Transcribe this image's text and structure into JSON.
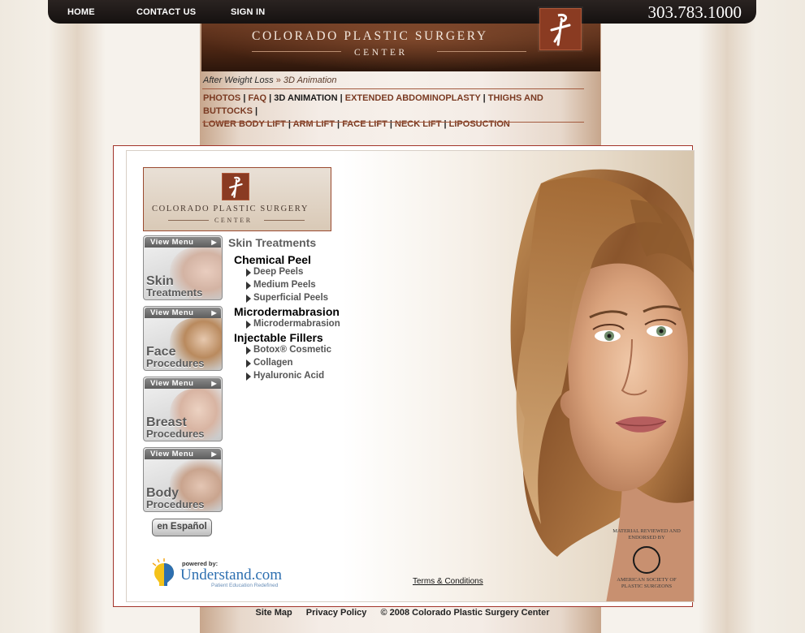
{
  "topnav": {
    "home": "HOME",
    "contact": "CONTACT US",
    "signin": "SIGN IN",
    "phone": "303.783.1000"
  },
  "banner": {
    "line1": "COLORADO PLASTIC SURGERY",
    "line2": "CENTER"
  },
  "breadcrumb": {
    "parent": "After Weight Loss",
    "separator": "»",
    "current": "3D Animation"
  },
  "subnav": {
    "items": [
      "PHOTOS",
      "FAQ",
      "3D ANIMATION",
      "EXTENDED ABDOMINOPLASTY",
      "THIGHS AND BUTTOCKS",
      "LOWER BODY LIFT",
      "ARM LIFT",
      "FACE LIFT",
      "NECK LIFT",
      "LIPOSUCTION"
    ],
    "active": "3D ANIMATION",
    "separator": "|"
  },
  "panel_logo": {
    "line1": "COLORADO PLASTIC SURGERY",
    "line2": "CENTER"
  },
  "categories": [
    {
      "view_menu": "View Menu",
      "word1": "Skin",
      "word2": "Treatments"
    },
    {
      "view_menu": "View Menu",
      "word1": "Face",
      "word2": "Procedures"
    },
    {
      "view_menu": "View Menu",
      "word1": "Breast",
      "word2": "Procedures"
    },
    {
      "view_menu": "View Menu",
      "word1": "Body",
      "word2": "Procedures"
    }
  ],
  "espanol_button": "en Español",
  "menu": {
    "title": "Skin Treatments",
    "groups": [
      {
        "label": "Chemical Peel",
        "items": [
          "Deep Peels",
          "Medium Peels",
          "Superficial Peels"
        ]
      },
      {
        "label": "Microdermabrasion",
        "items": [
          "Microdermabrasion"
        ]
      },
      {
        "label": "Injectable Fillers",
        "items": [
          "Botox® Cosmetic",
          "Collagen",
          "Hyaluronic Acid"
        ]
      }
    ]
  },
  "understand": {
    "powered_by": "powered by:",
    "brand": "Understand.com",
    "tagline": "Patient Education Redefined"
  },
  "terms": "Terms & Conditions",
  "asps": {
    "top": "MATERIAL REVIEWED AND ENDORSED BY",
    "bottom": "AMERICAN SOCIETY OF PLASTIC SURGEONS"
  },
  "footer": {
    "sitemap": "Site Map",
    "privacy": "Privacy Policy",
    "copyright": "© 2008 Colorado Plastic Surgery Center"
  },
  "colors": {
    "accent": "#7a3a22",
    "frame": "#a2342a",
    "topbar": "#1b1615"
  }
}
